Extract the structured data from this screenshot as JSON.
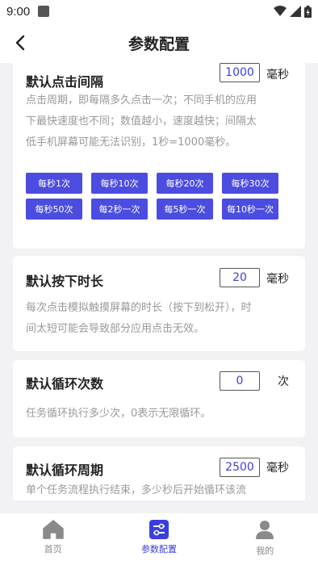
{
  "status": {
    "time": "9:00"
  },
  "header": {
    "title": "参数配置"
  },
  "cards": {
    "click_interval": {
      "title": "默认点击间隔",
      "value": "1000",
      "unit": "毫秒",
      "desc_lines": [
        "点击周期，即每隔多久点击一次；不同手机的应用",
        "下最快速度也不同；数值越小，速度越快；间隔太",
        "低手机屏幕可能无法识别，1秒=1000毫秒。"
      ],
      "presets": [
        "每秒1次",
        "每秒10次",
        "每秒20次",
        "每秒30次",
        "每秒50次",
        "每2秒一次",
        "每5秒一次",
        "每10秒一次"
      ]
    },
    "press_duration": {
      "title": "默认按下时长",
      "value": "20",
      "unit": "毫秒",
      "desc_lines": [
        "每次点击模拟触摸屏幕的时长（按下到松开），时",
        "间太短可能会导致部分应用点击无效。"
      ]
    },
    "loop_count": {
      "title": "默认循环次数",
      "value": "0",
      "unit": "次",
      "desc_lines": [
        "任务循环执行多少次，0表示无限循环。"
      ]
    },
    "loop_period": {
      "title": "默认循环周期",
      "value": "2500",
      "unit": "毫秒",
      "desc_lines": [
        "单个任务流程执行结束，多少秒后开始循环该流"
      ]
    }
  },
  "tabs": [
    {
      "label": "首页",
      "icon": "home-icon",
      "active": false
    },
    {
      "label": "参数配置",
      "icon": "sliders-icon",
      "active": true
    },
    {
      "label": "我的",
      "icon": "user-icon",
      "active": false
    }
  ],
  "colors": {
    "accent": "#3b3fdd",
    "button": "#4c4ce0",
    "background": "#f2f2f4"
  }
}
